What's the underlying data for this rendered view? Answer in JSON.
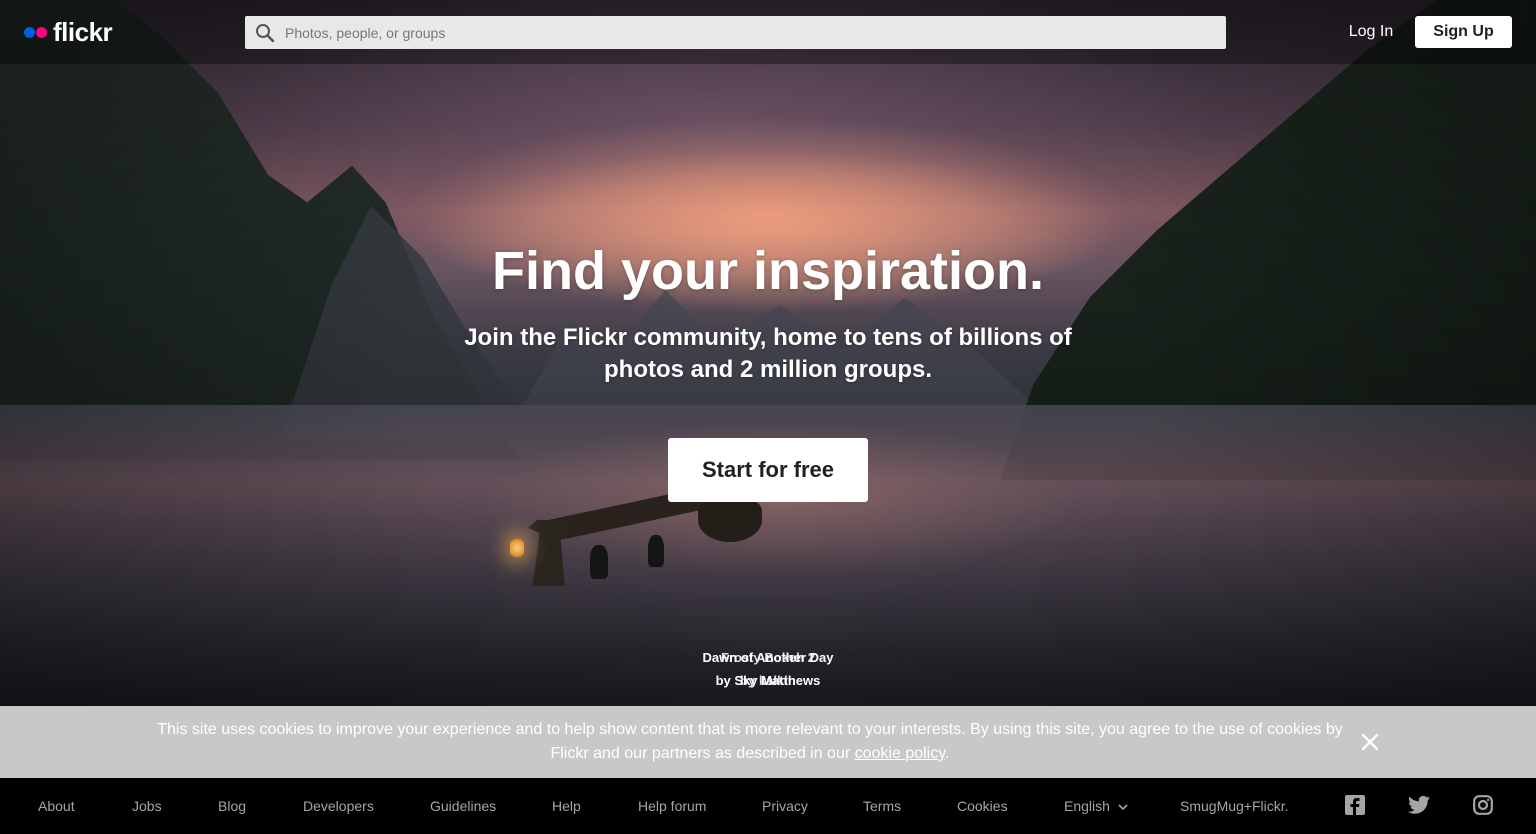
{
  "header": {
    "logo_text": "flickr",
    "search_placeholder": "Photos, people, or groups",
    "login_label": "Log In",
    "signup_label": "Sign Up"
  },
  "hero": {
    "headline": "Find your inspiration.",
    "subhead": "Join the Flickr community, home to tens of billions of photos and 2 million groups.",
    "cta_label": "Start for free",
    "credits": [
      {
        "title": "Dawn of Another Day",
        "author": "by Sky Matthews"
      },
      {
        "title": "Frosty Bokeh 2",
        "author": "by kalkin"
      }
    ]
  },
  "cookie_banner": {
    "text": "This site uses cookies to improve your experience and to help show content that is more relevant to your interests. By using this site, you agree to the use of cookies by Flickr and our partners as described in our ",
    "link_label": "cookie policy",
    "text_end": "."
  },
  "footer": {
    "links": [
      "About",
      "Jobs",
      "Blog",
      "Developers",
      "Guidelines",
      "Help",
      "Help forum",
      "Privacy",
      "Terms",
      "Cookies"
    ],
    "language": "English",
    "brand": "SmugMug+Flickr.",
    "social": [
      "facebook-icon",
      "twitter-icon",
      "instagram-icon"
    ]
  },
  "colors": {
    "flickr_blue": "#0063dc",
    "flickr_pink": "#ff0084",
    "cookie_bg": "#c8c8c8",
    "footer_bg": "#000000",
    "footer_text": "#a5a5a5"
  }
}
